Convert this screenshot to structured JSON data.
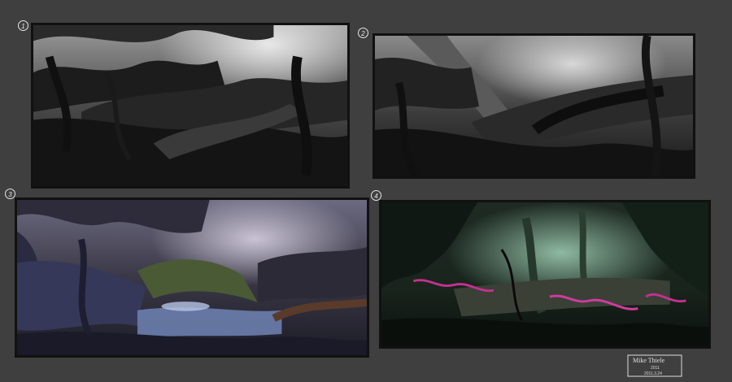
{
  "panels": [
    {
      "number": "1",
      "palette": "grayscale"
    },
    {
      "number": "2",
      "palette": "grayscale"
    },
    {
      "number": "3",
      "palette": "purple-blue"
    },
    {
      "number": "4",
      "palette": "green-magenta"
    }
  ],
  "signature": {
    "name": "Mike Thiele",
    "lines": [
      "Mike Thiele",
      "2011",
      "2011.3.24"
    ]
  },
  "colors": {
    "background": "#3f3f3f",
    "frame": "#111111",
    "panel3_accent": "#7a8fc0",
    "panel4_accent": "#c43090"
  }
}
